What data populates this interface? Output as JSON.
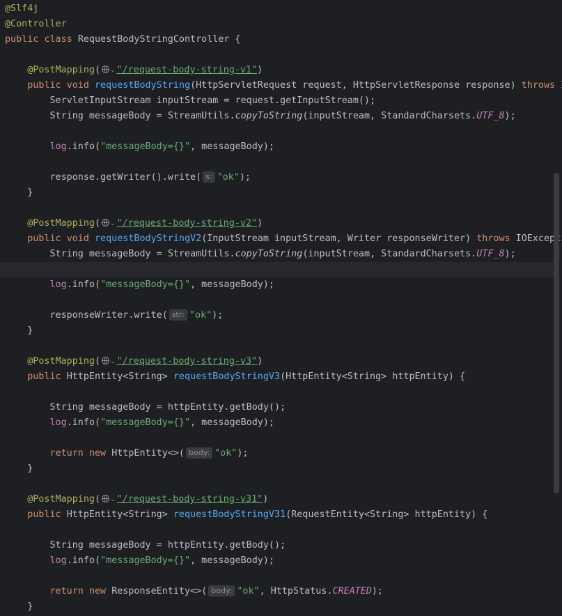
{
  "code": {
    "annotation_slf4j": "@Slf4j",
    "annotation_controller": "@Controller",
    "kw_public": "public",
    "kw_class": "class",
    "kw_void": "void",
    "kw_throws": "throws",
    "kw_return": "return",
    "kw_new": "new",
    "class_name": "RequestBodyStringController",
    "open_brace": " {",
    "close_brace": "}",
    "post_mapping": "@PostMapping",
    "log": "log",
    "info_call": ".info(",
    "log_message": "\"messageBody={}\"",
    "log_args_end": ", messageBody);",
    "ok_string": "\"ok\"",
    "string_message_body": "String messageBody = ",
    "stream_utils": "StreamUtils.",
    "copy_to_string": "copyToString",
    "copy_args": "(inputStream, StandardCharsets.",
    "utf8": "UTF_8",
    "copy_end": ");",
    "methods": [
      {
        "path": "\"/request-body-string-v1\"",
        "name": "requestBodyString",
        "params": "(HttpServletRequest request, HttpServletResponse response) ",
        "throws_rest": " I",
        "line2": "ServletInputStream inputStream = request.getInputStream();",
        "write_prefix": "response.getWriter().write(",
        "hint": "s:",
        "write_end": ");"
      },
      {
        "path": "\"/request-body-string-v2\"",
        "name": "requestBodyStringV2",
        "params": "(InputStream inputStream, Writer responseWriter) ",
        "throws_rest": " IOExcepti",
        "write_prefix": "responseWriter.write(",
        "hint": "str:",
        "write_end": ");"
      },
      {
        "path": "\"/request-body-string-v3\"",
        "name": "requestBodyStringV3",
        "return_type": "HttpEntity<String> ",
        "params": "(HttpEntity<String> httpEntity) {",
        "body_line": "httpEntity.getBody();",
        "return_prefix": "HttpEntity<>(",
        "hint": "body:",
        "return_end": ");"
      },
      {
        "path": "\"/request-body-string-v31\"",
        "name": "requestBodyStringV31",
        "return_type": "HttpEntity<String> ",
        "params": "(RequestEntity<String> httpEntity) {",
        "body_line": "httpEntity.getBody();",
        "return_prefix": "ResponseEntity<>(",
        "hint": "body:",
        "return_mid": ", HttpStatus.",
        "status": "CREATED",
        "return_end": ");"
      }
    ]
  }
}
